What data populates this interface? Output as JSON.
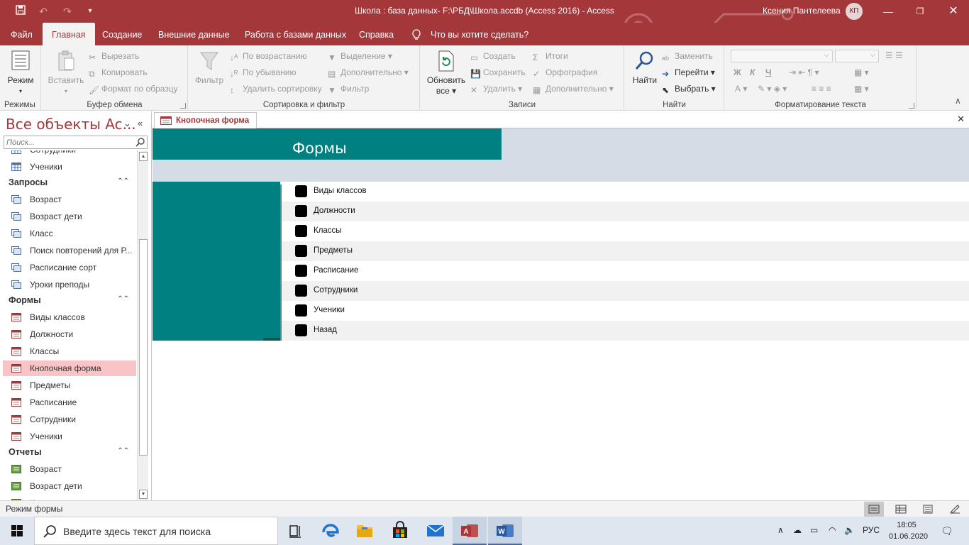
{
  "window": {
    "title": "Школа : база данных- F:\\РБД\\Школа.accdb (Access 2016)  -  Access",
    "user_name": "Ксения Пантелеева",
    "user_initials": "КП"
  },
  "menu_tabs": [
    "Файл",
    "Главная",
    "Создание",
    "Внешние данные",
    "Работа с базами данных",
    "Справка"
  ],
  "tell_me": "Что вы хотите сделать?",
  "ribbon": {
    "mode": {
      "label": "Режим",
      "group": "Режимы"
    },
    "clipboard": {
      "paste": "Вставить",
      "cut": "Вырезать",
      "copy": "Копировать",
      "format_painter": "Формат по образцу",
      "group": "Буфер обмена"
    },
    "sort_filter": {
      "filter": "Фильтр",
      "ascending": "По возрастанию",
      "descending": "По убыванию",
      "remove_sort": "Удалить сортировку",
      "selection": "Выделение",
      "advanced": "Дополнительно",
      "toggle_filter": "Фильтр",
      "group": "Сортировка и фильтр"
    },
    "records": {
      "refresh": "Обновить",
      "refresh2": "все",
      "new": "Создать",
      "save": "Сохранить",
      "delete": "Удалить",
      "totals": "Итоги",
      "spelling": "Орфография",
      "more": "Дополнительно",
      "group": "Записи"
    },
    "find": {
      "find": "Найти",
      "replace": "Заменить",
      "goto": "Перейти",
      "select": "Выбрать",
      "group": "Найти"
    },
    "text_format": {
      "bold": "Ж",
      "italic": "К",
      "underline": "Ч",
      "font_color": "А",
      "group": "Форматирование текста"
    }
  },
  "nav": {
    "title": "Все объекты Ac...",
    "search_placeholder": "Поиск...",
    "top_items": [
      "Сотрудники",
      "Ученики"
    ],
    "categories": [
      {
        "name": "Запросы",
        "items": [
          "Возраст",
          "Возраст дети",
          "Класс",
          "Поиск повторений для Р...",
          "Расписание сорт",
          "Уроки преподы"
        ]
      },
      {
        "name": "Формы",
        "items": [
          "Виды классов",
          "Должности",
          "Классы",
          "Кнопочная форма",
          "Предметы",
          "Расписание",
          "Сотрудники",
          "Ученики"
        ]
      },
      {
        "name": "Отчеты",
        "items": [
          "Возраст",
          "Возраст дети",
          "Класс"
        ]
      }
    ],
    "selected": "Кнопочная форма"
  },
  "document": {
    "tab_label": "Кнопочная форма",
    "form_title": "Формы",
    "buttons": [
      "Виды классов",
      "Должности",
      "Классы",
      "Предметы",
      "Расписание",
      "Сотрудники",
      "Ученики",
      "Назад"
    ]
  },
  "status": {
    "text": "Режим формы"
  },
  "taskbar": {
    "search_placeholder": "Введите здесь текст для поиска",
    "language": "РУС",
    "time": "18:05",
    "date": "01.06.2020"
  },
  "colors": {
    "accent": "#a4373a",
    "form_teal": "#008080",
    "form_header_bg": "#d5dce5",
    "selected_item": "#f8c4c5"
  }
}
